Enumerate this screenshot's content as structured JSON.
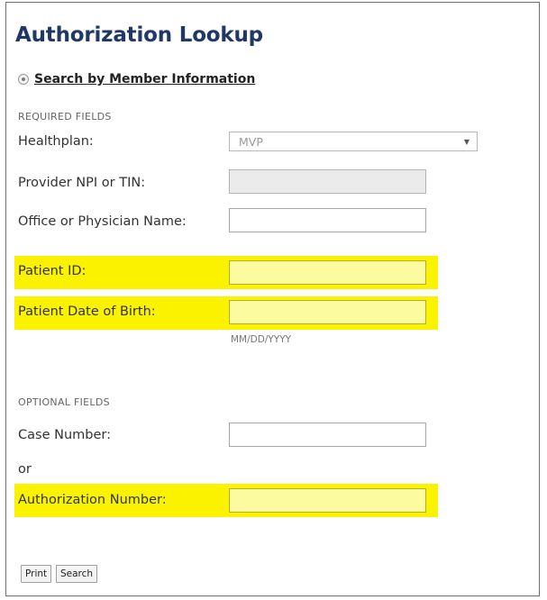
{
  "page": {
    "title": "Authorization Lookup",
    "search_mode_label": "Search by Member Information"
  },
  "required": {
    "section_label": "REQUIRED FIELDS",
    "healthplan": {
      "label": "Healthplan:",
      "value": "MVP"
    },
    "provider": {
      "label": "Provider NPI or TIN:",
      "value": ""
    },
    "office": {
      "label": "Office or Physician Name:",
      "value": ""
    },
    "patient_id": {
      "label": "Patient ID:",
      "value": ""
    },
    "patient_dob": {
      "label": "Patient Date of Birth:",
      "value": "",
      "hint": "MM/DD/YYYY"
    }
  },
  "optional": {
    "section_label": "OPTIONAL FIELDS",
    "case_number": {
      "label": "Case Number:",
      "value": ""
    },
    "or_text": "or",
    "authorization_number": {
      "label": "Authorization Number:",
      "value": ""
    }
  },
  "buttons": {
    "print_label": "Print",
    "search_label": "Search"
  },
  "colors": {
    "title": "#1f3864",
    "highlight": "#fbf200"
  },
  "icons": {
    "radio": "radio-selected-icon",
    "dropdown": "chevron-down-icon"
  }
}
